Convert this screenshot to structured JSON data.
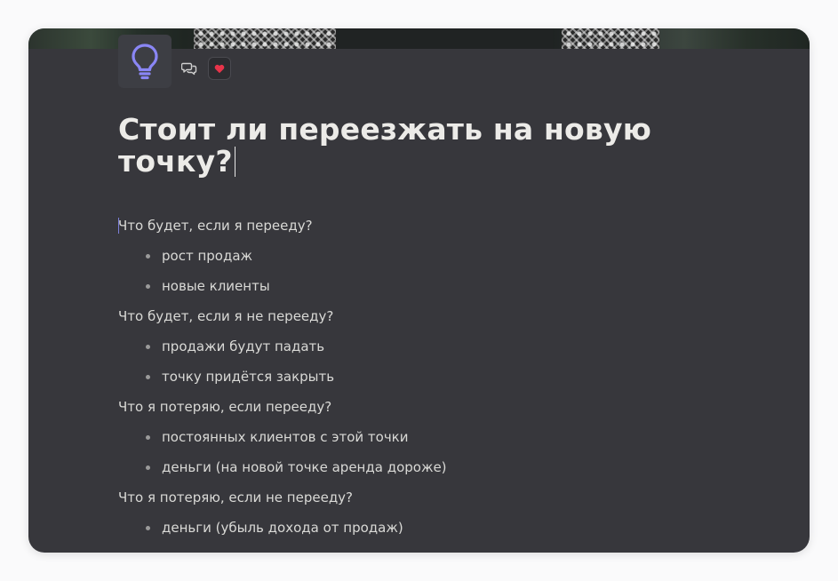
{
  "page": {
    "title": "Стоит ли переезжать на новую точку?",
    "icon": "lightbulb-icon",
    "reaction": "heart-emoji",
    "accent_color": "#7f7bf0"
  },
  "content": {
    "lines": [
      {
        "kind": "text",
        "text": "Что будет, если я перееду?"
      },
      {
        "kind": "bullet",
        "text": "рост продаж"
      },
      {
        "kind": "bullet",
        "text": "новые клиенты"
      },
      {
        "kind": "text",
        "text": "Что будет, если я не перееду?"
      },
      {
        "kind": "bullet",
        "text": "продажи будут падать"
      },
      {
        "kind": "bullet",
        "text": "точку придётся закрыть"
      },
      {
        "kind": "text",
        "text": "Что я потеряю, если перееду?"
      },
      {
        "kind": "bullet",
        "text": "постоянных клиентов с этой точки"
      },
      {
        "kind": "bullet",
        "text": "деньги (на новой точке аренда дороже)"
      },
      {
        "kind": "text",
        "text": "Что я потеряю, если не перееду?"
      },
      {
        "kind": "bullet",
        "text": "деньги (убыль дохода от продаж)"
      }
    ]
  }
}
